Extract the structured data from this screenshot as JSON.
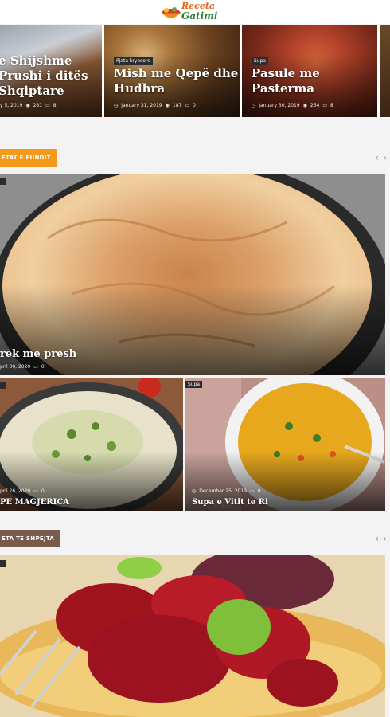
{
  "header": {
    "logo_line1": "Receta",
    "logo_line2": "Gatimi"
  },
  "slider": [
    {
      "title": "e Shijshme Prushi i ditës Shqiptare",
      "date": "y 5, 2019",
      "views": "281",
      "comments": "8"
    },
    {
      "tag": "Pjata kryesore",
      "title": "Mish me Qepë dhe Hudhra",
      "date": "January 31, 2019",
      "views": "187",
      "comments": "0"
    },
    {
      "tag": "Supa",
      "title": "Pasule me Pasterma",
      "date": "January 30, 2019",
      "views": "254",
      "comments": "8"
    }
  ],
  "section1": {
    "label": "ETAT E FUNDIT",
    "label_color": "#f39a1d",
    "prev": "‹",
    "next": "›",
    "main": {
      "title": "rek me presh",
      "date": "pril 30, 2020",
      "comments": "0"
    },
    "left": {
      "title": "PE MAGJERICA",
      "date": "pril 26, 2020",
      "comments": "0"
    },
    "right": {
      "tag": "Supa",
      "title": "Supa e Vitit te Ri",
      "date": "December 25, 2019",
      "comments": "0"
    }
  },
  "section2": {
    "label": "ETA TE SHPEJTA",
    "label_color": "#7a5a4a",
    "prev": "‹",
    "next": "›"
  },
  "icons": {
    "eye": "eye-icon",
    "comment": "comment-icon",
    "clock": "clock-icon"
  }
}
